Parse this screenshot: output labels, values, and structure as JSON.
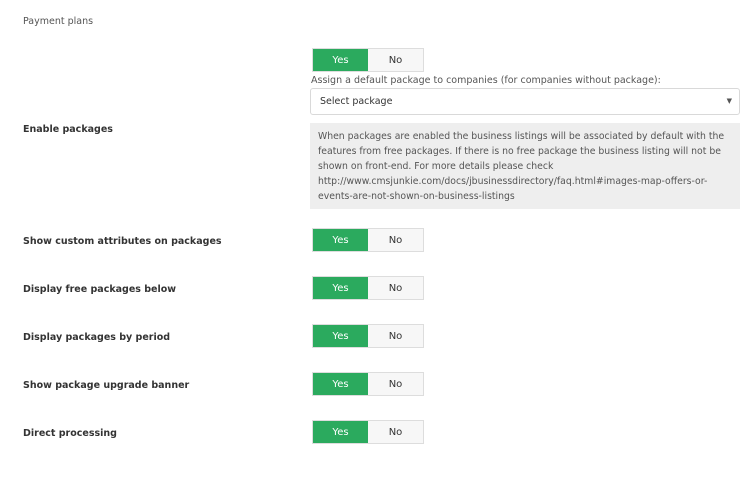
{
  "section": {
    "title": "Payment plans"
  },
  "enable_packages": {
    "label": "Enable packages",
    "yes": "Yes",
    "no": "No",
    "assign_label": "Assign a default package to companies (for companies without package):",
    "select_value": "Select package",
    "info_lines": [
      "When packages are enabled the business listings will be associated by default with the",
      "features from free packages. If there is no free package the business listing will not be",
      "shown on front-end. For more details please check",
      "http://www.cmsjunkie.com/docs/jbusinessdirectory/faq.html#images-map-offers-or-",
      "events-are-not-shown-on-business-listings"
    ]
  },
  "settings": [
    {
      "label": "Show custom attributes on packages",
      "yes": "Yes",
      "no": "No"
    },
    {
      "label": "Display free packages below",
      "yes": "Yes",
      "no": "No"
    },
    {
      "label": "Display packages by period",
      "yes": "Yes",
      "no": "No"
    },
    {
      "label": "Show package upgrade banner",
      "yes": "Yes",
      "no": "No"
    },
    {
      "label": "Direct processing",
      "yes": "Yes",
      "no": "No"
    }
  ],
  "colors": {
    "active": "#2baa5e",
    "inactive": "#f7f7f7",
    "info_bg": "#eeeeee"
  },
  "icons": {
    "select_arrow": "caret-down-icon"
  }
}
